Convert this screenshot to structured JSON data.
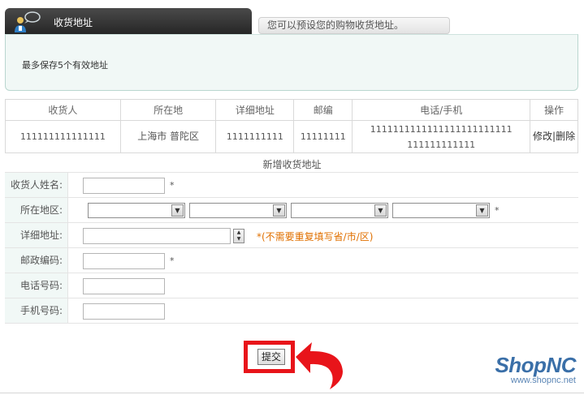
{
  "header": {
    "tab_label": "收货地址",
    "hint_tab": "您可以预设您的购物收货地址。"
  },
  "notice": "最多保存5个有效地址",
  "table": {
    "headers": [
      "收货人",
      "所在地",
      "详细地址",
      "邮编",
      "电话/手机",
      "操作"
    ],
    "rows": [
      {
        "name": "111111111111111",
        "region": "上海市 普陀区",
        "address": "1111111111",
        "zip": "11111111",
        "phone_line1": "1111111111111111111111111",
        "phone_line2": "111111111111",
        "edit": "修改",
        "sep": "|",
        "delete": "删除"
      }
    ]
  },
  "form": {
    "title": "新增收货地址",
    "name_label": "收货人姓名:",
    "region_label": "所在地区:",
    "address_label": "详细地址:",
    "zip_label": "邮政编码:",
    "phone_label": "电话号码:",
    "mobile_label": "手机号码:",
    "required_mark": "*",
    "address_hint": "*(不需要重复填写省/市/区)",
    "submit": "提交"
  },
  "logo": {
    "name": "ShopNC",
    "url": "www.shopnc.net"
  },
  "colors": {
    "tab_dark": "#333333",
    "accent_red": "#e8141a",
    "hint_orange": "#e07000",
    "label_bg": "#f1f8f6",
    "logo_blue": "#3a6fa8"
  }
}
